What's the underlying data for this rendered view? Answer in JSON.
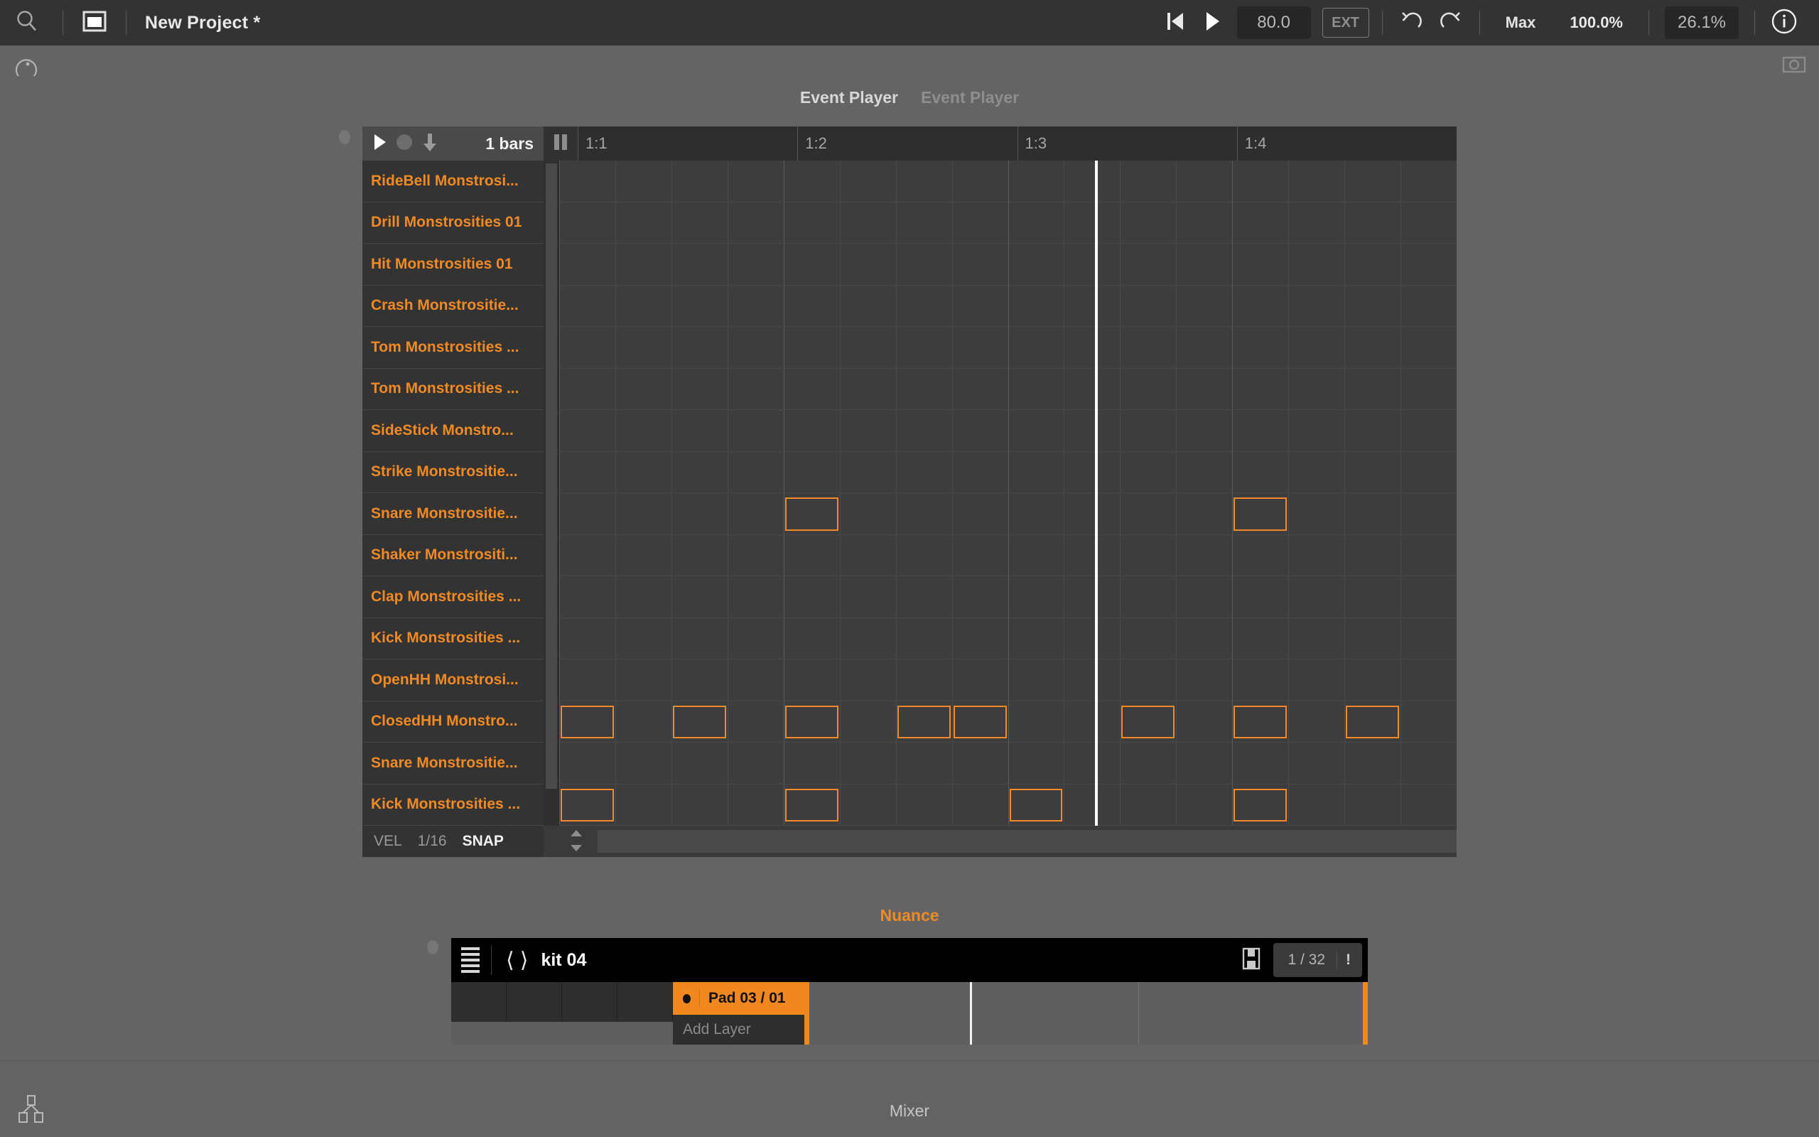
{
  "topbar": {
    "search_icon": "search-icon",
    "window_icon": "window-icon",
    "project_title": "New Project *",
    "rewind_icon": "rewind-to-start-icon",
    "play_icon": "play-icon",
    "tempo": "80.0",
    "ext_label": "EXT",
    "undo_icon": "undo-icon",
    "redo_icon": "redo-icon",
    "quality_label": "Max",
    "cpu_percent": "100.0%",
    "load_percent": "26.1%",
    "info_icon": "info-icon",
    "knob_icon": "knob-icon",
    "camera_icon": "camera-icon"
  },
  "event_player": {
    "tab_active": "Event Player",
    "tab_inactive": "Event Player"
  },
  "sequencer": {
    "transport": {
      "play_icon": "play-icon",
      "record_icon": "record-icon",
      "download_icon": "download-icon",
      "length": "1 bars",
      "pause_icon": "pause-icon"
    },
    "ruler": [
      "1:1",
      "1:2",
      "1:3",
      "1:4"
    ],
    "tracks": [
      "RideBell Monstrosi...",
      "Drill Monstrosities 01",
      "Hit Monstrosities 01",
      "Crash Monstrositie...",
      "Tom Monstrosities ...",
      "Tom Monstrosities ...",
      "SideStick Monstro...",
      "Strike Monstrositie...",
      "Snare Monstrositie...",
      "Shaker Monstrositi...",
      "Clap Monstrosities ...",
      "Kick Monstrosities ...",
      "OpenHH Monstrosi...",
      "ClosedHH Monstro...",
      "Snare Monstrositie...",
      "Kick Monstrosities ..."
    ],
    "notes": [
      {
        "track": 8,
        "step": 4
      },
      {
        "track": 8,
        "step": 12
      },
      {
        "track": 13,
        "step": 0
      },
      {
        "track": 13,
        "step": 2
      },
      {
        "track": 13,
        "step": 4
      },
      {
        "track": 13,
        "step": 6
      },
      {
        "track": 13,
        "step": 7
      },
      {
        "track": 13,
        "step": 10
      },
      {
        "track": 13,
        "step": 12
      },
      {
        "track": 13,
        "step": 14
      },
      {
        "track": 15,
        "step": 0
      },
      {
        "track": 15,
        "step": 4
      },
      {
        "track": 15,
        "step": 8
      },
      {
        "track": 15,
        "step": 12
      }
    ],
    "playhead_step": 9.55,
    "footer": {
      "vel_label": "VEL",
      "snap_value": "1/16",
      "snap_label": "SNAP"
    }
  },
  "nuance": {
    "title": "Nuance",
    "menu_icon": "hamburger-icon",
    "prev_icon": "chevron-left-icon",
    "next_icon": "chevron-right-icon",
    "kit_name": "kit 04",
    "save_icon": "save-icon",
    "page_count": "1 / 32",
    "alert_label": "!",
    "selected_pad": "Pad 03 / 01",
    "add_layer_label": "Add Layer"
  },
  "bottombar": {
    "tree_icon": "hierarchy-icon",
    "mixer_label": "Mixer"
  }
}
